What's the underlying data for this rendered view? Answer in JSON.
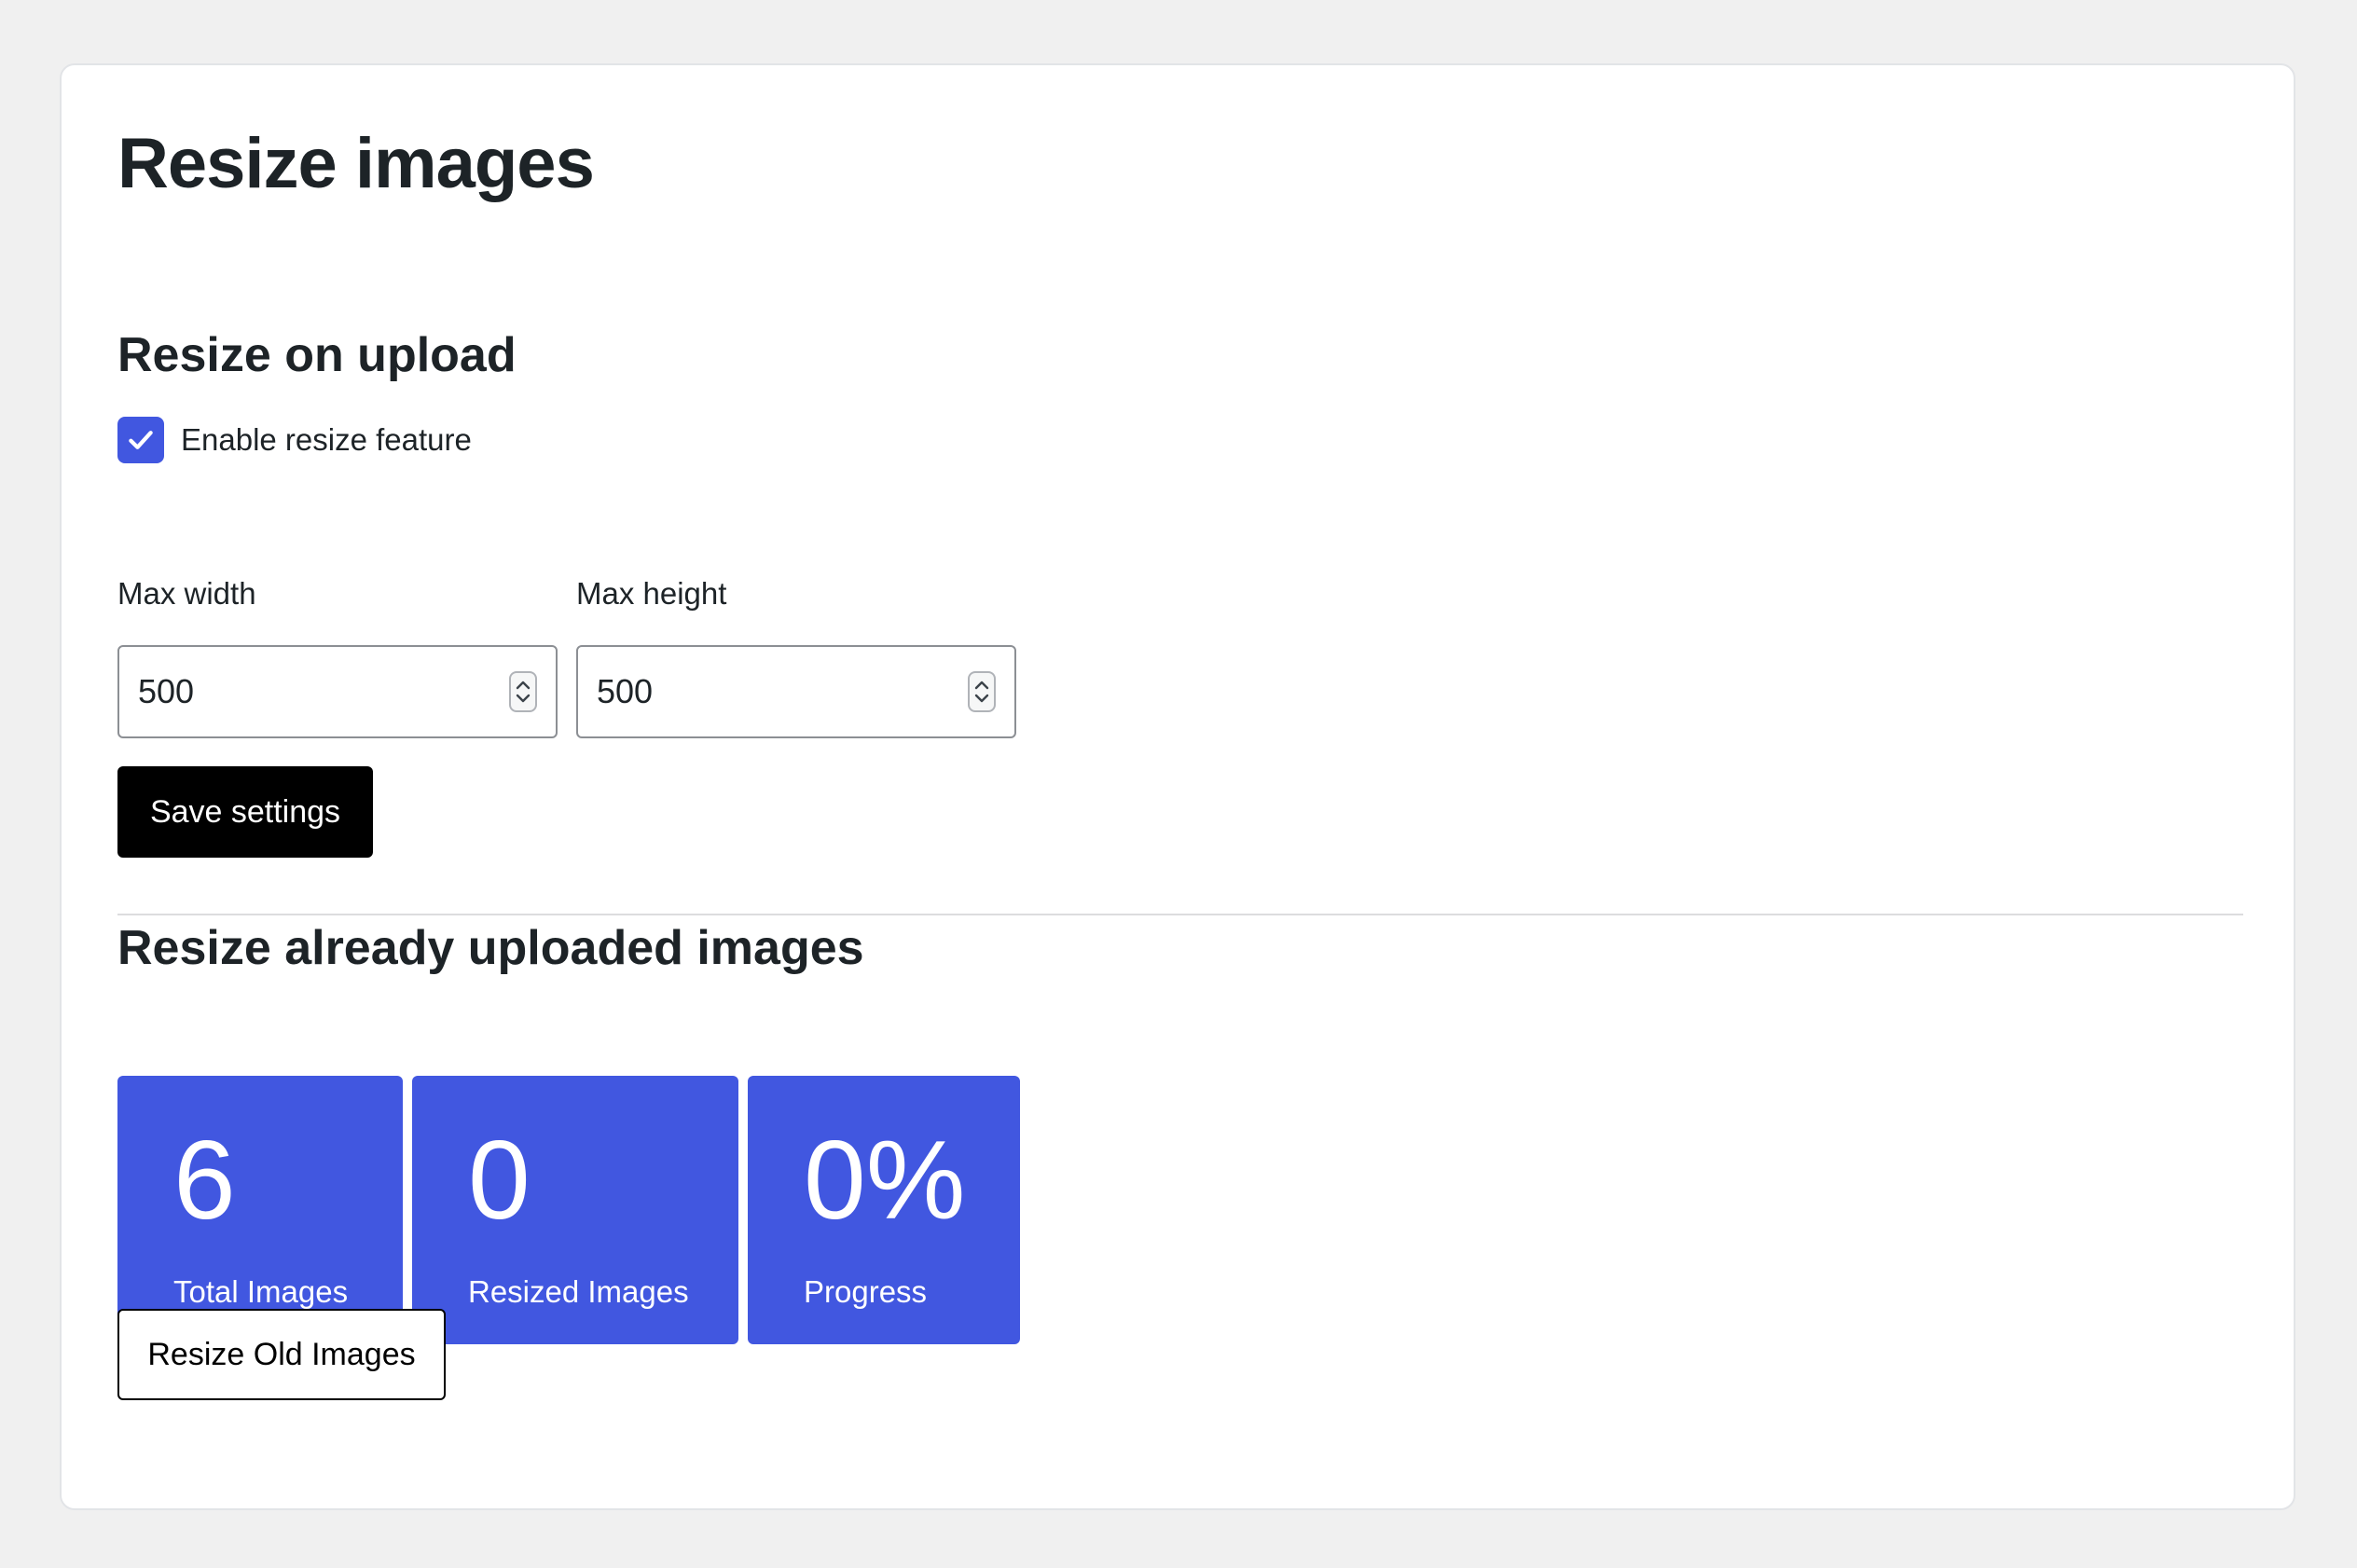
{
  "page": {
    "title": "Resize images"
  },
  "upload_section": {
    "title": "Resize on upload",
    "enable_checkbox": {
      "label": "Enable resize feature",
      "checked": true
    },
    "max_width": {
      "label": "Max width",
      "value": "500"
    },
    "max_height": {
      "label": "Max height",
      "value": "500"
    },
    "save_label": "Save settings"
  },
  "existing_section": {
    "title": "Resize already uploaded images",
    "stats": {
      "total": {
        "value": "6",
        "label": "Total Images"
      },
      "resized": {
        "value": "0",
        "label": "Resized Images"
      },
      "progress": {
        "value": "0%",
        "label": "Progress"
      }
    },
    "resize_button_label": "Resize Old Images"
  },
  "colors": {
    "accent": "#4157e0",
    "background": "#f0f0f0",
    "card": "#ffffff",
    "primary_button": "#000000"
  },
  "icons": {
    "checkbox": "check-icon",
    "spinner": "stepper-arrows-icon"
  }
}
